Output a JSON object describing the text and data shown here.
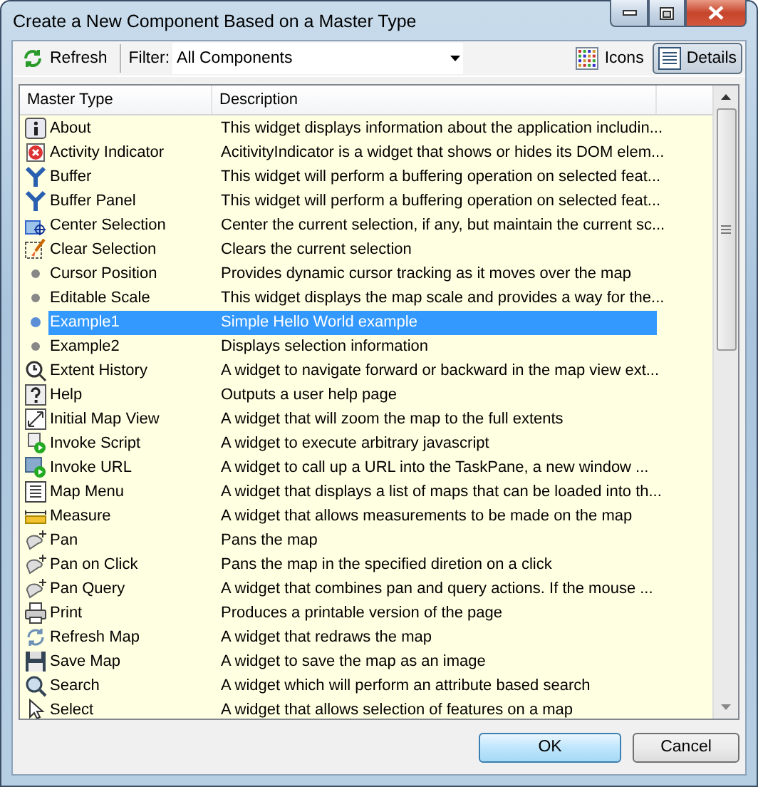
{
  "window": {
    "title": "Create a New Component Based on a Master Type"
  },
  "toolbar": {
    "refresh": "Refresh",
    "filter_label": "Filter:",
    "filter_value": "All Components",
    "view_buttons": [
      {
        "label": "Icons",
        "selected": false
      },
      {
        "label": "Details",
        "selected": true
      }
    ]
  },
  "table": {
    "columns": [
      "Master Type",
      "Description"
    ],
    "rows": [
      {
        "name": "About",
        "description": "This widget displays information about the application includin...",
        "selected": false
      },
      {
        "name": "Activity Indicator",
        "description": "AcitivityIndicator is a widget that shows or hides its DOM elem...",
        "selected": false
      },
      {
        "name": "Buffer",
        "description": "This widget will perform a buffering operation on selected feat...",
        "selected": false
      },
      {
        "name": "Buffer Panel",
        "description": "This widget will perform a buffering operation on selected feat...",
        "selected": false
      },
      {
        "name": "Center Selection",
        "description": "Center the current selection, if any, but maintain the current sc...",
        "selected": false
      },
      {
        "name": "Clear Selection",
        "description": "Clears the current selection",
        "selected": false
      },
      {
        "name": "Cursor Position",
        "description": "Provides dynamic cursor tracking as it moves over the map",
        "selected": false
      },
      {
        "name": "Editable Scale",
        "description": "This widget displays the map scale and provides a way for the...",
        "selected": false
      },
      {
        "name": "Example1",
        "description": "Simple Hello World example",
        "selected": true
      },
      {
        "name": "Example2",
        "description": "Displays selection information",
        "selected": false
      },
      {
        "name": "Extent History",
        "description": "A widget to navigate forward or backward in the map view ext...",
        "selected": false
      },
      {
        "name": "Help",
        "description": "Outputs a user help page",
        "selected": false
      },
      {
        "name": "Initial Map View",
        "description": "A widget that will zoom the map to the full extents",
        "selected": false
      },
      {
        "name": "Invoke Script",
        "description": "A widget to execute arbitrary javascript",
        "selected": false
      },
      {
        "name": "Invoke URL",
        "description": "A widget to call up a URL into the TaskPane, a new window ...",
        "selected": false
      },
      {
        "name": "Map Menu",
        "description": "A widget that displays a list of maps that can be loaded into th...",
        "selected": false
      },
      {
        "name": "Measure",
        "description": "A widget that allows measurements to be made on the map",
        "selected": false
      },
      {
        "name": "Pan",
        "description": "Pans the map",
        "selected": false
      },
      {
        "name": "Pan on Click",
        "description": "Pans the map in the specified diretion on a click",
        "selected": false
      },
      {
        "name": "Pan Query",
        "description": "A widget that combines pan and query actions.  If the mouse ...",
        "selected": false
      },
      {
        "name": "Print",
        "description": "Produces a printable version of the page",
        "selected": false
      },
      {
        "name": "Refresh Map",
        "description": "A widget that redraws the map",
        "selected": false
      },
      {
        "name": "Save Map",
        "description": "A widget to save the map as an image",
        "selected": false
      },
      {
        "name": "Search",
        "description": "A widget which will perform an attribute based search",
        "selected": false
      },
      {
        "name": "Select",
        "description": "A widget that allows selection of features on a map",
        "selected": false
      }
    ]
  },
  "buttons": [
    "OK",
    "Cancel"
  ]
}
